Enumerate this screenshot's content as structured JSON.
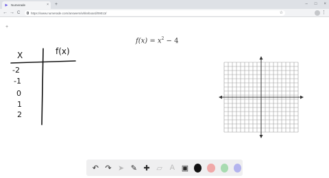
{
  "browser": {
    "tab_title": "Numerade",
    "tab_close": "×",
    "new_tab": "+",
    "url": "https://www.numerade.com/answers/whiteboard/09013/",
    "back": "←",
    "forward": "→",
    "reload": "C",
    "star": "☆",
    "menu": "⋮",
    "minimize": "–",
    "maximize": "□",
    "close": "×"
  },
  "canvas": {
    "add_button": "+",
    "equation": {
      "lhs": "f(x)",
      "eq": " = ",
      "var": "x",
      "power": "2",
      "rest": " − 4"
    },
    "table": {
      "header_x": "X",
      "header_fx": "f(x)",
      "x_values": [
        "-2",
        "-1",
        "0",
        "1",
        "2"
      ]
    }
  },
  "palette": {
    "tools": [
      {
        "name": "undo-icon",
        "glyph": "↶"
      },
      {
        "name": "redo-icon",
        "glyph": "↷"
      },
      {
        "name": "pointer-icon",
        "glyph": "➤"
      },
      {
        "name": "pen-icon",
        "glyph": "✎"
      },
      {
        "name": "add-icon",
        "glyph": "✚"
      },
      {
        "name": "eraser-icon",
        "glyph": "▱"
      },
      {
        "name": "text-icon",
        "glyph": "A"
      },
      {
        "name": "image-icon",
        "glyph": "▣"
      }
    ],
    "colors": [
      "#111111",
      "#f0a8a8",
      "#a8dbb0",
      "#b4b4ee"
    ]
  }
}
